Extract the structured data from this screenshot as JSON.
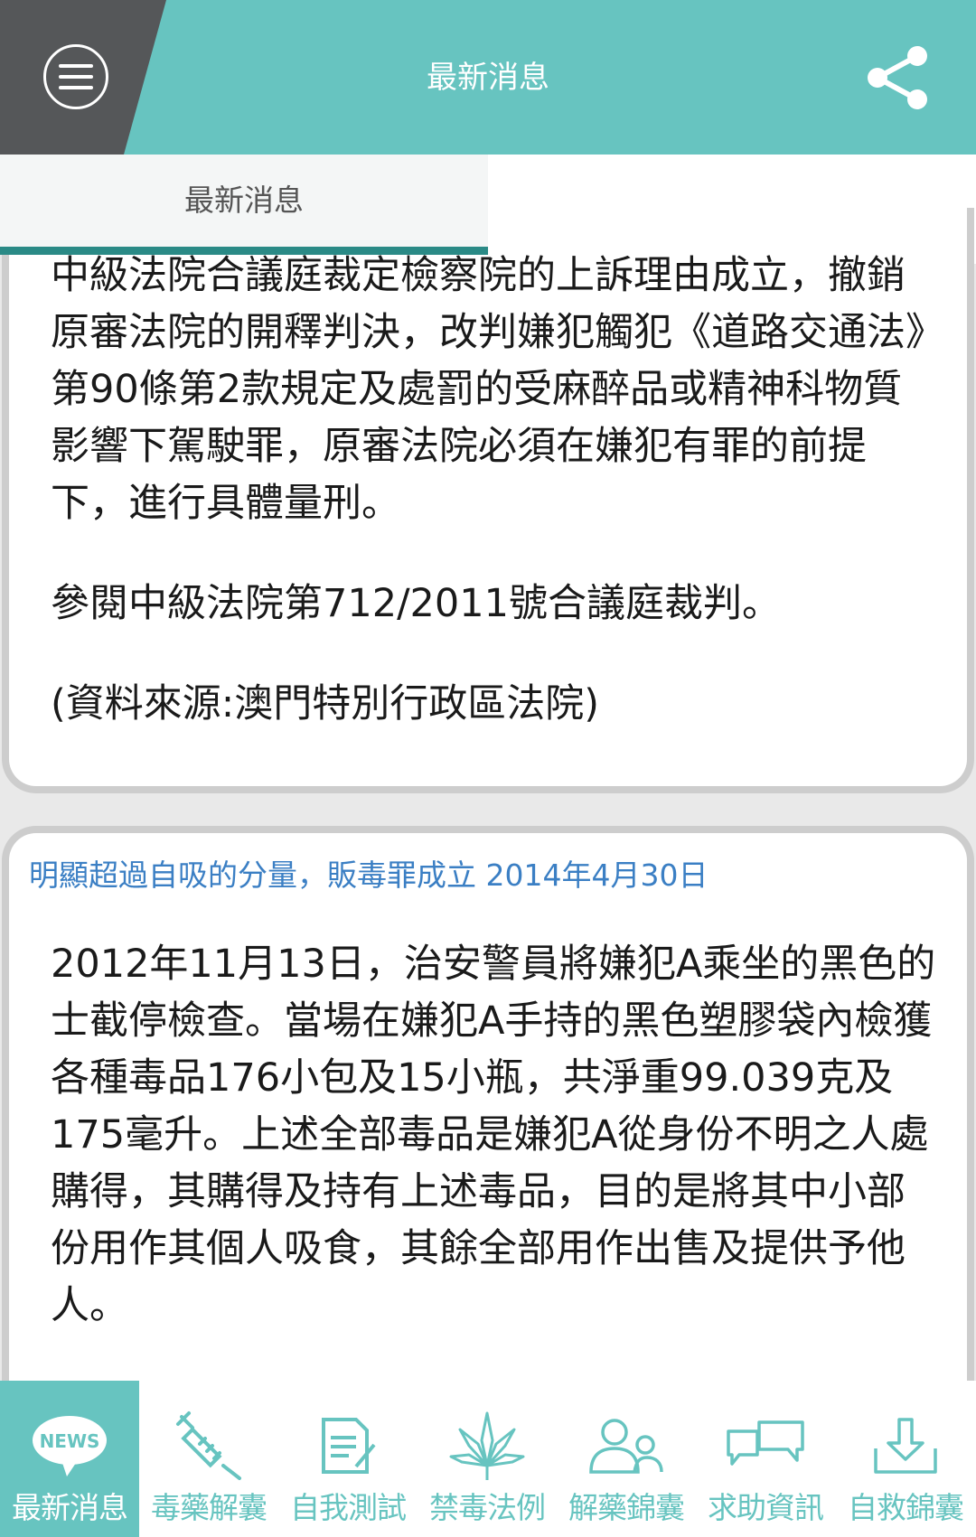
{
  "header": {
    "title": "最新消息",
    "menu_icon": "hamburger-icon",
    "share_icon": "share-icon"
  },
  "subtab": {
    "label": "最新消息"
  },
  "colors": {
    "teal": "#67c4c0",
    "dark": "#555759",
    "title_blue": "#3b7fc4",
    "active_line": "#2a8a86"
  },
  "article1": {
    "paragraphs": [
      "中級法院合議庭裁定檢察院的上訴理由成立，撤銷原審法院的開釋判決，改判嫌犯觸犯《道路交通法》第90條第2款規定及處罰的受麻醉品或精神科物質影響下駕駛罪，原審法院必須在嫌犯有罪的前提下，進行具體量刑。",
      "參閱中級法院第712/2011號合議庭裁判。",
      "(資料來源:澳門特別行政區法院)"
    ]
  },
  "article2": {
    "title": "明顯超過自吸的分量，販毒罪成立 2014年4月30日",
    "body": "2012年11月13日，治安警員將嫌犯A乘坐的黑色的士截停檢查。當場在嫌犯A手持的黑色塑膠袋內檢獲各種毒品176小包及15小瓶，共淨重99.039克及175毫升。上述全部毒品是嫌犯A從身份不明之人處購得，其購得及持有上述毒品，目的是將其中小部份用作其個人吸食，其餘全部用作出售及提供予他人。"
  },
  "nav": {
    "items": [
      {
        "label": "最新消息",
        "icon": "news-icon",
        "active": true,
        "badge": "NEWS"
      },
      {
        "label": "毒藥解囊",
        "icon": "syringe-icon"
      },
      {
        "label": "自我測試",
        "icon": "document-pen-icon"
      },
      {
        "label": "禁毒法例",
        "icon": "cannabis-leaf-icon"
      },
      {
        "label": "解藥錦囊",
        "icon": "people-icon"
      },
      {
        "label": "求助資訊",
        "icon": "chat-bubbles-icon"
      },
      {
        "label": "自救錦囊",
        "icon": "download-icon"
      }
    ]
  }
}
